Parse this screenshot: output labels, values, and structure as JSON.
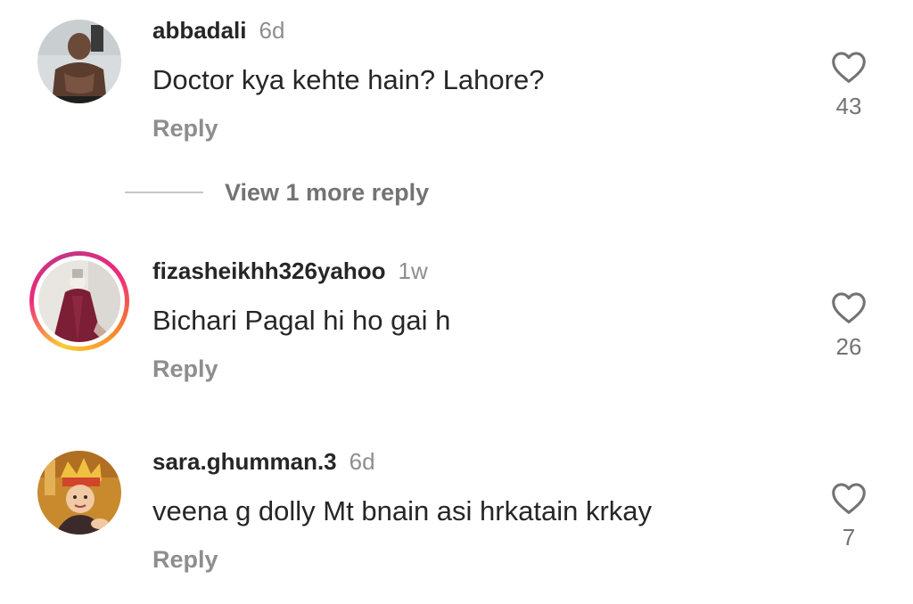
{
  "comments": [
    {
      "username": "abbadali",
      "time": "6d",
      "text": "Doctor kya kehte hain? Lahore?",
      "reply_label": "Reply",
      "likes": "43"
    },
    {
      "username": "fizasheikhh326yahoo",
      "time": "1w",
      "text": "Bichari Pagal hi ho gai h",
      "reply_label": "Reply",
      "likes": "26"
    },
    {
      "username": "sara.ghumman.3",
      "time": "6d",
      "text": "veena g dolly Mt bnain asi hrkatain krkay",
      "reply_label": "Reply",
      "likes": "7"
    }
  ],
  "view_replies": {
    "label": "View 1 more reply"
  },
  "icons": {
    "like": "heart-outline-icon"
  },
  "colors": {
    "primary_text": "#262626",
    "secondary_text": "#8e8e8e",
    "story_ring": "#ee2a7b"
  }
}
